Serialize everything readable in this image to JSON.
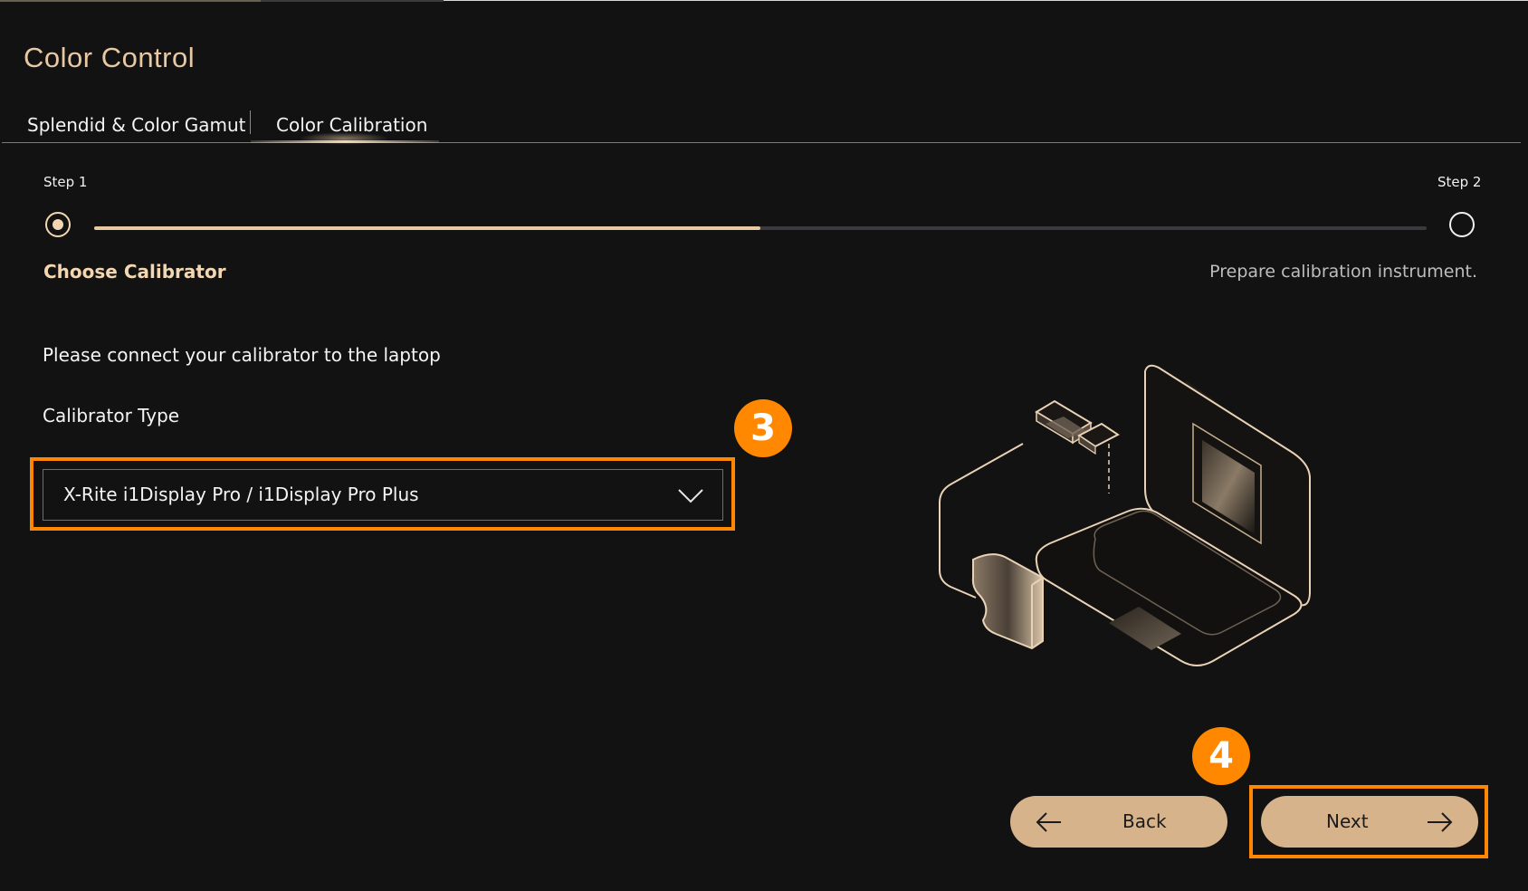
{
  "app": {
    "title": "Color Control"
  },
  "tabs": [
    {
      "label": "Splendid & Color Gamut",
      "active": false
    },
    {
      "label": "Color Calibration",
      "active": true
    }
  ],
  "stepper": {
    "step1": {
      "label": "Step 1",
      "title": "Choose Calibrator",
      "active": true
    },
    "step2": {
      "label": "Step 2",
      "description": "Prepare calibration instrument.",
      "active": false
    },
    "progress_fraction": 0.5
  },
  "form": {
    "instruction": "Please connect your calibrator to the laptop",
    "calibrator_type_label": "Calibrator Type",
    "calibrator_selected": "X-Rite i1Display Pro / i1Display Pro Plus"
  },
  "annotations": {
    "dropdown_badge": "3",
    "next_badge": "4",
    "highlight_color": "#ff8800"
  },
  "buttons": {
    "back_label": "Back",
    "next_label": "Next"
  },
  "icons": {
    "back": "arrow-left-icon",
    "next": "arrow-right-icon",
    "dropdown": "chevron-down-icon"
  },
  "colors": {
    "accent": "#e9c9a3",
    "button_fill": "#d7b38c",
    "background": "#121212"
  }
}
